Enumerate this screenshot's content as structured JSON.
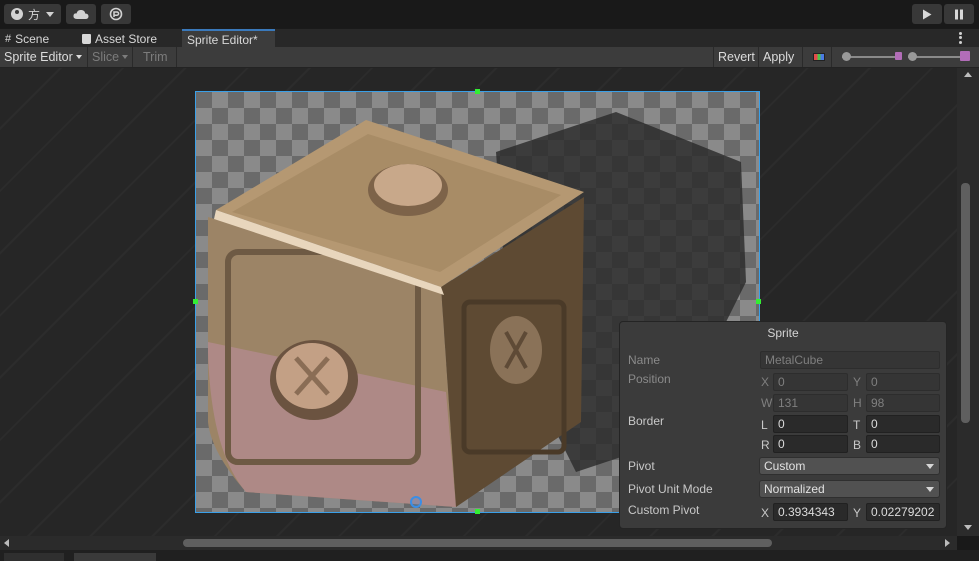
{
  "toolbar": {
    "account_label": "方",
    "play_icon": "play-icon",
    "pause_icon": "pause-icon"
  },
  "tabs": [
    {
      "label": "Scene",
      "icon": "scene-grid-icon"
    },
    {
      "label": "Asset Store",
      "icon": "shopping-bag-icon"
    },
    {
      "label": "Sprite Editor*"
    }
  ],
  "editor_toolbar": {
    "mode": "Sprite Editor",
    "slice": "Slice",
    "trim": "Trim",
    "revert": "Revert",
    "apply": "Apply"
  },
  "sprite_panel": {
    "title": "Sprite",
    "name_label": "Name",
    "name_value": "MetalCube",
    "position_label": "Position",
    "x_label": "X",
    "x_value": "0",
    "y_label": "Y",
    "y_value": "0",
    "w_label": "W",
    "w_value": "131",
    "h_label": "H",
    "h_value": "98",
    "border_label": "Border",
    "l_label": "L",
    "l_value": "0",
    "t_label": "T",
    "t_value": "0",
    "r_label": "R",
    "r_value": "0",
    "b_label": "B",
    "b_value": "0",
    "pivot_label": "Pivot",
    "pivot_value": "Custom",
    "pivot_unit_label": "Pivot Unit Mode",
    "pivot_unit_value": "Normalized",
    "custom_pivot_label": "Custom Pivot",
    "cpx_label": "X",
    "cpx_value": "0.3934343",
    "cpy_label": "Y",
    "cpy_value": "0.02279202"
  },
  "colors": {
    "accent": "#3a79bb",
    "selection_outline": "#3aa0e8",
    "handle": "#33ee33"
  }
}
